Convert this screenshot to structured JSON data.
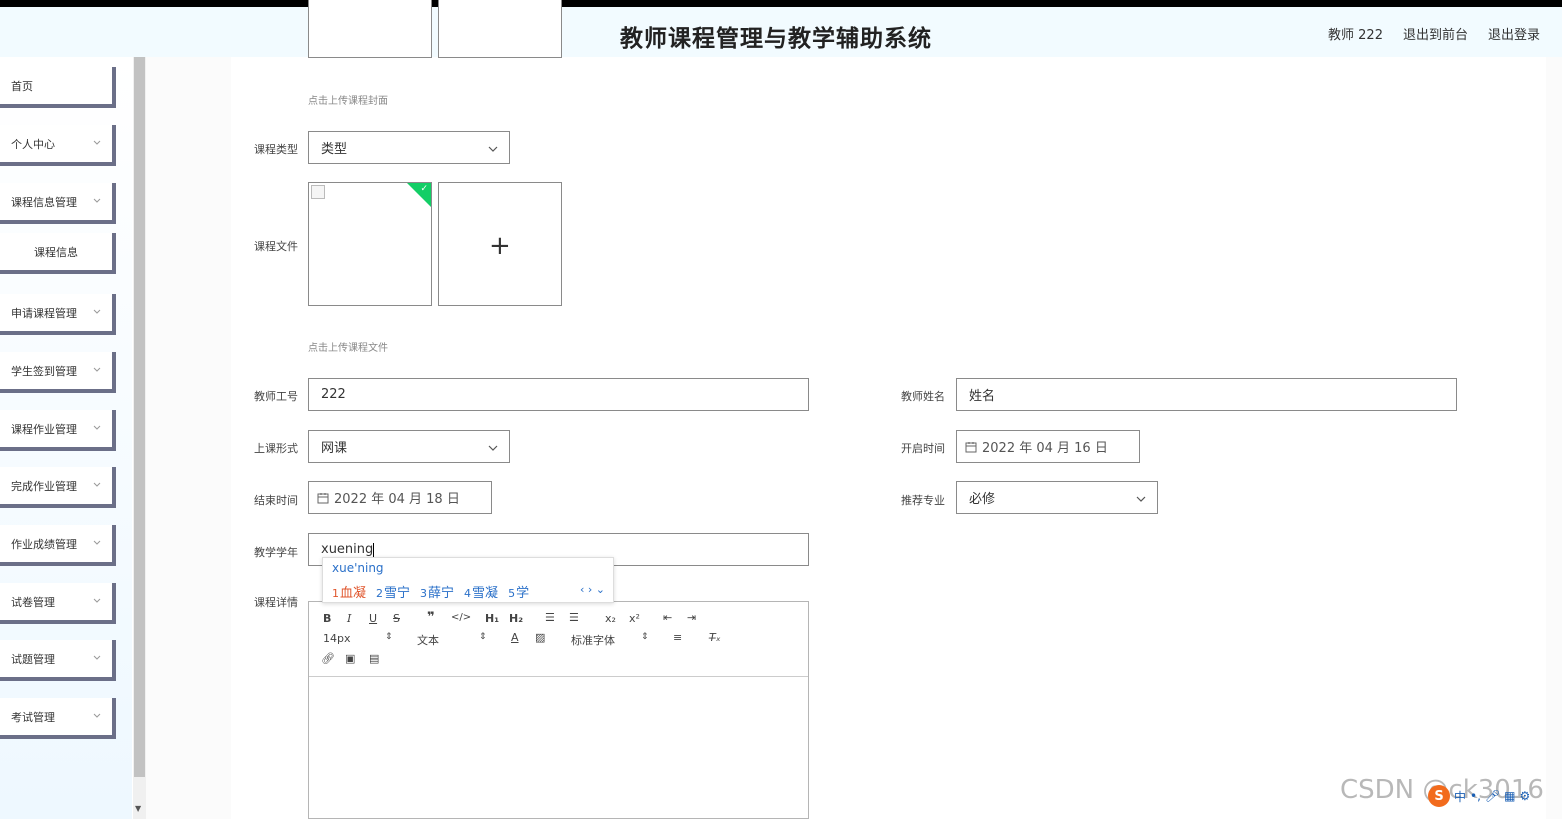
{
  "header": {
    "title": "教师课程管理与教学辅助系统",
    "user": "教师 222",
    "to_front": "退出到前台",
    "logout": "退出登录"
  },
  "sidebar": {
    "items": [
      {
        "label": "首页",
        "has_chevron": false
      },
      {
        "label": "个人中心",
        "has_chevron": true
      },
      {
        "label": "课程信息管理",
        "has_chevron": true
      },
      {
        "label": "课程信息",
        "sub": true
      },
      {
        "label": "申请课程管理",
        "has_chevron": true
      },
      {
        "label": "学生签到管理",
        "has_chevron": true
      },
      {
        "label": "课程作业管理",
        "has_chevron": true
      },
      {
        "label": "完成作业管理",
        "has_chevron": true
      },
      {
        "label": "作业成绩管理",
        "has_chevron": true
      },
      {
        "label": "试卷管理",
        "has_chevron": true
      },
      {
        "label": "试题管理",
        "has_chevron": true
      },
      {
        "label": "考试管理",
        "has_chevron": true
      }
    ]
  },
  "form": {
    "cover_hint": "点击上传课程封面",
    "course_type": {
      "label": "课程类型",
      "value": "类型"
    },
    "course_file": {
      "label": "课程文件",
      "hint": "点击上传课程文件"
    },
    "teacher_id": {
      "label": "教师工号",
      "value": "222"
    },
    "teacher_name": {
      "label": "教师姓名",
      "value": "姓名"
    },
    "class_form": {
      "label": "上课形式",
      "value": "网课"
    },
    "start_time": {
      "label": "开启时间",
      "value": "2022 年 04 月 16 日"
    },
    "end_time": {
      "label": "结束时间",
      "value": "2022 年 04 月 18 日"
    },
    "major": {
      "label": "推荐专业",
      "value": "必修"
    },
    "school_year": {
      "label": "教学学年",
      "value": "xuening"
    },
    "details": {
      "label": "课程详情"
    }
  },
  "editor": {
    "font_size": "14px",
    "paragraph": "文本",
    "font_family": "标准字体"
  },
  "ime": {
    "pinyin": "xue'ning",
    "candidates": [
      {
        "num": "1",
        "text": "血凝"
      },
      {
        "num": "2",
        "text": "雪宁"
      },
      {
        "num": "3",
        "text": "薛宁"
      },
      {
        "num": "4",
        "text": "雪凝"
      },
      {
        "num": "5",
        "text": "学"
      }
    ]
  },
  "watermark": "CSDN @ck3016"
}
